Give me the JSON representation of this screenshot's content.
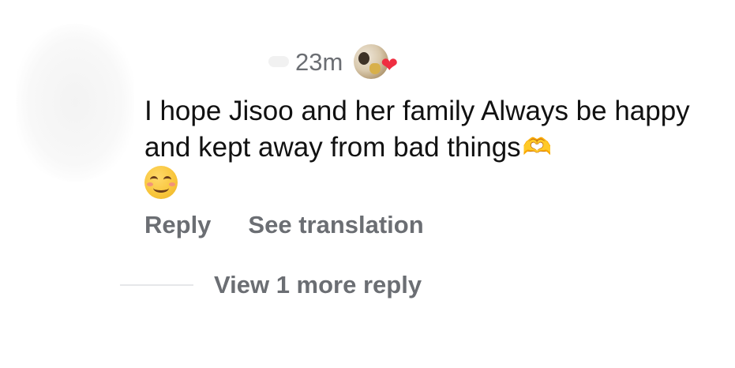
{
  "comment": {
    "timestamp": "23m",
    "text": "I hope Jisoo and her family Always be happy and kept away from bad things",
    "trailing_emoji_name": "heart-hands-icon",
    "second_line_emoji_name": "smiling-face-icon",
    "creator_like_icon": "heart-icon",
    "heart_color": "#ef2e41"
  },
  "actions": {
    "reply_label": "Reply",
    "translate_label": "See translation"
  },
  "replies": {
    "view_more_label": "View 1 more reply"
  },
  "colors": {
    "secondary_text": "#6b6e73",
    "primary_text": "#111111",
    "divider": "#e6e7e9"
  }
}
